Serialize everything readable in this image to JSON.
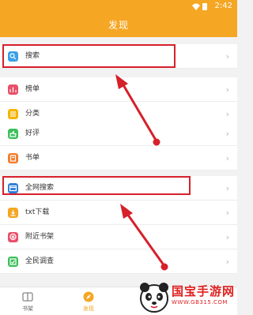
{
  "status_bar": {
    "time": "2:42"
  },
  "header": {
    "title": "发现"
  },
  "menu": [
    {
      "id": "search",
      "label": "搜索",
      "icon": "search-icon",
      "color": "#3aa0e6"
    },
    {
      "id": "ranking",
      "label": "榜单",
      "icon": "ranking-icon",
      "color": "#e8506a"
    },
    {
      "id": "category",
      "label": "分类",
      "icon": "category-icon",
      "color": "#f5b400"
    },
    {
      "id": "reviews",
      "label": "好评",
      "icon": "thumb-up-icon",
      "color": "#3cbf5a"
    },
    {
      "id": "booklist",
      "label": "书单",
      "icon": "booklist-icon",
      "color": "#f57c2a"
    },
    {
      "id": "web_search",
      "label": "全网搜索",
      "icon": "web-search-icon",
      "color": "#2a7bd6"
    },
    {
      "id": "txt_download",
      "label": "txt下载",
      "icon": "download-icon",
      "color": "#f5a623"
    },
    {
      "id": "nearby",
      "label": "附近书架",
      "icon": "nearby-icon",
      "color": "#e8506a"
    },
    {
      "id": "survey",
      "label": "全民调查",
      "icon": "survey-icon",
      "color": "#3cbf5a"
    }
  ],
  "bottom_nav": [
    {
      "label": "书架",
      "icon": "bookshelf-icon",
      "active": false
    },
    {
      "label": "发现",
      "icon": "discover-icon",
      "active": true
    }
  ],
  "watermark": {
    "title": "国宝手游网",
    "url": "WWW.GB315.COM"
  },
  "colors": {
    "accent": "#f5a623",
    "annotation": "#d6202a"
  }
}
